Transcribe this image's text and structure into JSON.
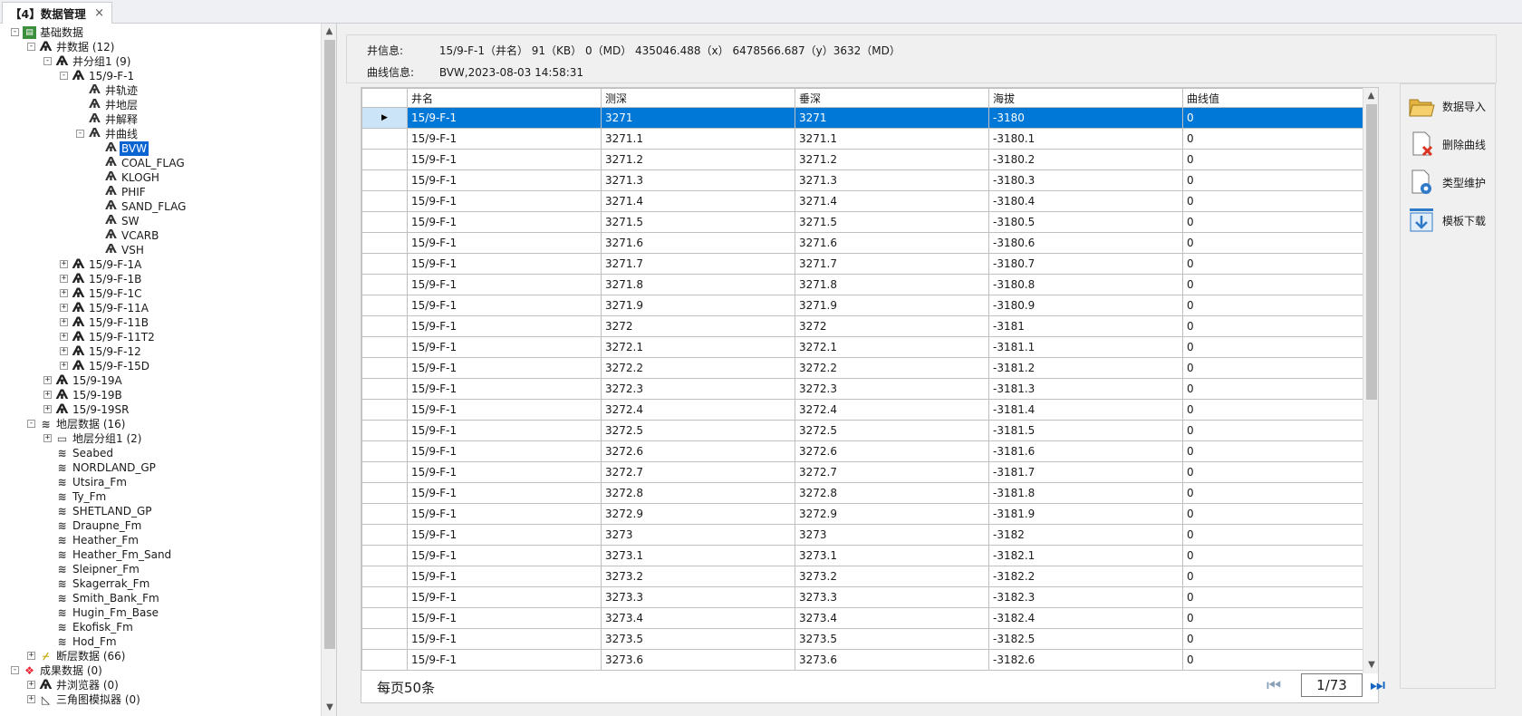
{
  "tab": {
    "title": "【4】数据管理",
    "close": "×"
  },
  "tree": [
    {
      "label": "基础数据",
      "lvl": 0,
      "exp": "-",
      "icon": "root",
      "glyph": "▤"
    },
    {
      "label": "井数据 (12)",
      "lvl": 1,
      "exp": "-",
      "icon": "well",
      "glyph": "Ѧ"
    },
    {
      "label": "井分组1 (9)",
      "lvl": 2,
      "exp": "-",
      "icon": "well",
      "glyph": "Ѧ"
    },
    {
      "label": "15/9-F-1",
      "lvl": 3,
      "exp": "-",
      "icon": "well",
      "glyph": "Ѧ"
    },
    {
      "label": "井轨迹",
      "lvl": 4,
      "exp": "",
      "icon": "curve",
      "glyph": "Ѧ"
    },
    {
      "label": "井地层",
      "lvl": 4,
      "exp": "",
      "icon": "curve",
      "glyph": "Ѧ"
    },
    {
      "label": "井解释",
      "lvl": 4,
      "exp": "",
      "icon": "curve",
      "glyph": "Ѧ"
    },
    {
      "label": "井曲线",
      "lvl": 4,
      "exp": "-",
      "icon": "curve",
      "glyph": "Ѧ"
    },
    {
      "label": "BVW",
      "lvl": 5,
      "exp": "",
      "icon": "curve",
      "glyph": "Ѧ",
      "selected": true
    },
    {
      "label": "COAL_FLAG",
      "lvl": 5,
      "exp": "",
      "icon": "curve",
      "glyph": "Ѧ"
    },
    {
      "label": "KLOGH",
      "lvl": 5,
      "exp": "",
      "icon": "curve",
      "glyph": "Ѧ"
    },
    {
      "label": "PHIF",
      "lvl": 5,
      "exp": "",
      "icon": "curve",
      "glyph": "Ѧ"
    },
    {
      "label": "SAND_FLAG",
      "lvl": 5,
      "exp": "",
      "icon": "curve",
      "glyph": "Ѧ"
    },
    {
      "label": "SW",
      "lvl": 5,
      "exp": "",
      "icon": "curve",
      "glyph": "Ѧ"
    },
    {
      "label": "VCARB",
      "lvl": 5,
      "exp": "",
      "icon": "curve",
      "glyph": "Ѧ"
    },
    {
      "label": "VSH",
      "lvl": 5,
      "exp": "",
      "icon": "curve",
      "glyph": "Ѧ"
    },
    {
      "label": "15/9-F-1A",
      "lvl": 3,
      "exp": "+",
      "icon": "well",
      "glyph": "Ѧ"
    },
    {
      "label": "15/9-F-1B",
      "lvl": 3,
      "exp": "+",
      "icon": "well",
      "glyph": "Ѧ"
    },
    {
      "label": "15/9-F-1C",
      "lvl": 3,
      "exp": "+",
      "icon": "well",
      "glyph": "Ѧ"
    },
    {
      "label": "15/9-F-11A",
      "lvl": 3,
      "exp": "+",
      "icon": "well",
      "glyph": "Ѧ"
    },
    {
      "label": "15/9-F-11B",
      "lvl": 3,
      "exp": "+",
      "icon": "well",
      "glyph": "Ѧ"
    },
    {
      "label": "15/9-F-11T2",
      "lvl": 3,
      "exp": "+",
      "icon": "well",
      "glyph": "Ѧ"
    },
    {
      "label": "15/9-F-12",
      "lvl": 3,
      "exp": "+",
      "icon": "well",
      "glyph": "Ѧ"
    },
    {
      "label": "15/9-F-15D",
      "lvl": 3,
      "exp": "+",
      "icon": "well",
      "glyph": "Ѧ"
    },
    {
      "label": "15/9-19A",
      "lvl": 2,
      "exp": "+",
      "icon": "well",
      "glyph": "Ѧ"
    },
    {
      "label": "15/9-19B",
      "lvl": 2,
      "exp": "+",
      "icon": "well",
      "glyph": "Ѧ"
    },
    {
      "label": "15/9-19SR",
      "lvl": 2,
      "exp": "+",
      "icon": "well",
      "glyph": "Ѧ"
    },
    {
      "label": "地层数据 (16)",
      "lvl": 1,
      "exp": "-",
      "icon": "layer",
      "glyph": "≋"
    },
    {
      "label": "地层分组1 (2)",
      "lvl": 2,
      "exp": "+",
      "icon": "layer",
      "glyph": "▭"
    },
    {
      "label": "Seabed",
      "lvl": 2,
      "exp": "",
      "icon": "layer",
      "glyph": "≋"
    },
    {
      "label": "NORDLAND_GP",
      "lvl": 2,
      "exp": "",
      "icon": "layer",
      "glyph": "≋"
    },
    {
      "label": "Utsira_Fm",
      "lvl": 2,
      "exp": "",
      "icon": "layer",
      "glyph": "≋"
    },
    {
      "label": "Ty_Fm",
      "lvl": 2,
      "exp": "",
      "icon": "layer",
      "glyph": "≋"
    },
    {
      "label": "SHETLAND_GP",
      "lvl": 2,
      "exp": "",
      "icon": "layer",
      "glyph": "≋"
    },
    {
      "label": "Draupne_Fm",
      "lvl": 2,
      "exp": "",
      "icon": "layer",
      "glyph": "≋"
    },
    {
      "label": "Heather_Fm",
      "lvl": 2,
      "exp": "",
      "icon": "layer",
      "glyph": "≋"
    },
    {
      "label": "Heather_Fm_Sand",
      "lvl": 2,
      "exp": "",
      "icon": "layer",
      "glyph": "≋"
    },
    {
      "label": "Sleipner_Fm",
      "lvl": 2,
      "exp": "",
      "icon": "layer",
      "glyph": "≋"
    },
    {
      "label": "Skagerrak_Fm",
      "lvl": 2,
      "exp": "",
      "icon": "layer",
      "glyph": "≋"
    },
    {
      "label": "Smith_Bank_Fm",
      "lvl": 2,
      "exp": "",
      "icon": "layer",
      "glyph": "≋"
    },
    {
      "label": "Hugin_Fm_Base",
      "lvl": 2,
      "exp": "",
      "icon": "layer",
      "glyph": "≋"
    },
    {
      "label": "Ekofisk_Fm",
      "lvl": 2,
      "exp": "",
      "icon": "layer",
      "glyph": "≋"
    },
    {
      "label": "Hod_Fm",
      "lvl": 2,
      "exp": "",
      "icon": "layer",
      "glyph": "≋"
    },
    {
      "label": "断层数据 (66)",
      "lvl": 1,
      "exp": "+",
      "icon": "fault",
      "glyph": "⌿"
    },
    {
      "label": "成果数据 (0)",
      "lvl": 0,
      "exp": "-",
      "icon": "res",
      "glyph": "❖"
    },
    {
      "label": "井浏览器 (0)",
      "lvl": 1,
      "exp": "+",
      "icon": "well",
      "glyph": "Ѧ"
    },
    {
      "label": "三角图模拟器 (0)",
      "lvl": 1,
      "exp": "+",
      "icon": "tri",
      "glyph": "◺"
    }
  ],
  "info": {
    "well_key": "井信息:",
    "well_val": "15/9-F-1（井名） 91（KB） 0（MD） 435046.488（x） 6478566.687（y）3632（MD）",
    "curve_key": "曲线信息:",
    "curve_val": "BVW,2023-08-03 14:58:31"
  },
  "grid": {
    "columns": [
      "井名",
      "测深",
      "垂深",
      "海拔",
      "曲线值"
    ],
    "selected_marker": "▶",
    "rows": [
      [
        "15/9-F-1",
        "3271",
        "3271",
        "-3180",
        "0"
      ],
      [
        "15/9-F-1",
        "3271.1",
        "3271.1",
        "-3180.1",
        "0"
      ],
      [
        "15/9-F-1",
        "3271.2",
        "3271.2",
        "-3180.2",
        "0"
      ],
      [
        "15/9-F-1",
        "3271.3",
        "3271.3",
        "-3180.3",
        "0"
      ],
      [
        "15/9-F-1",
        "3271.4",
        "3271.4",
        "-3180.4",
        "0"
      ],
      [
        "15/9-F-1",
        "3271.5",
        "3271.5",
        "-3180.5",
        "0"
      ],
      [
        "15/9-F-1",
        "3271.6",
        "3271.6",
        "-3180.6",
        "0"
      ],
      [
        "15/9-F-1",
        "3271.7",
        "3271.7",
        "-3180.7",
        "0"
      ],
      [
        "15/9-F-1",
        "3271.8",
        "3271.8",
        "-3180.8",
        "0"
      ],
      [
        "15/9-F-1",
        "3271.9",
        "3271.9",
        "-3180.9",
        "0"
      ],
      [
        "15/9-F-1",
        "3272",
        "3272",
        "-3181",
        "0"
      ],
      [
        "15/9-F-1",
        "3272.1",
        "3272.1",
        "-3181.1",
        "0"
      ],
      [
        "15/9-F-1",
        "3272.2",
        "3272.2",
        "-3181.2",
        "0"
      ],
      [
        "15/9-F-1",
        "3272.3",
        "3272.3",
        "-3181.3",
        "0"
      ],
      [
        "15/9-F-1",
        "3272.4",
        "3272.4",
        "-3181.4",
        "0"
      ],
      [
        "15/9-F-1",
        "3272.5",
        "3272.5",
        "-3181.5",
        "0"
      ],
      [
        "15/9-F-1",
        "3272.6",
        "3272.6",
        "-3181.6",
        "0"
      ],
      [
        "15/9-F-1",
        "3272.7",
        "3272.7",
        "-3181.7",
        "0"
      ],
      [
        "15/9-F-1",
        "3272.8",
        "3272.8",
        "-3181.8",
        "0"
      ],
      [
        "15/9-F-1",
        "3272.9",
        "3272.9",
        "-3181.9",
        "0"
      ],
      [
        "15/9-F-1",
        "3273",
        "3273",
        "-3182",
        "0"
      ],
      [
        "15/9-F-1",
        "3273.1",
        "3273.1",
        "-3182.1",
        "0"
      ],
      [
        "15/9-F-1",
        "3273.2",
        "3273.2",
        "-3182.2",
        "0"
      ],
      [
        "15/9-F-1",
        "3273.3",
        "3273.3",
        "-3182.3",
        "0"
      ],
      [
        "15/9-F-1",
        "3273.4",
        "3273.4",
        "-3182.4",
        "0"
      ],
      [
        "15/9-F-1",
        "3273.5",
        "3273.5",
        "-3182.5",
        "0"
      ],
      [
        "15/9-F-1",
        "3273.6",
        "3273.6",
        "-3182.6",
        "0"
      ]
    ]
  },
  "pager": {
    "per_page": "每页50条",
    "page": "1/73",
    "first_icon": "first-page-icon",
    "next_icon": "next-page-icon"
  },
  "tools": [
    {
      "label": "数据导入",
      "icon": "folder-open-icon"
    },
    {
      "label": "删除曲线",
      "icon": "delete-file-icon"
    },
    {
      "label": "类型维护",
      "icon": "gear-file-icon"
    },
    {
      "label": "模板下载",
      "icon": "download-icon"
    }
  ]
}
